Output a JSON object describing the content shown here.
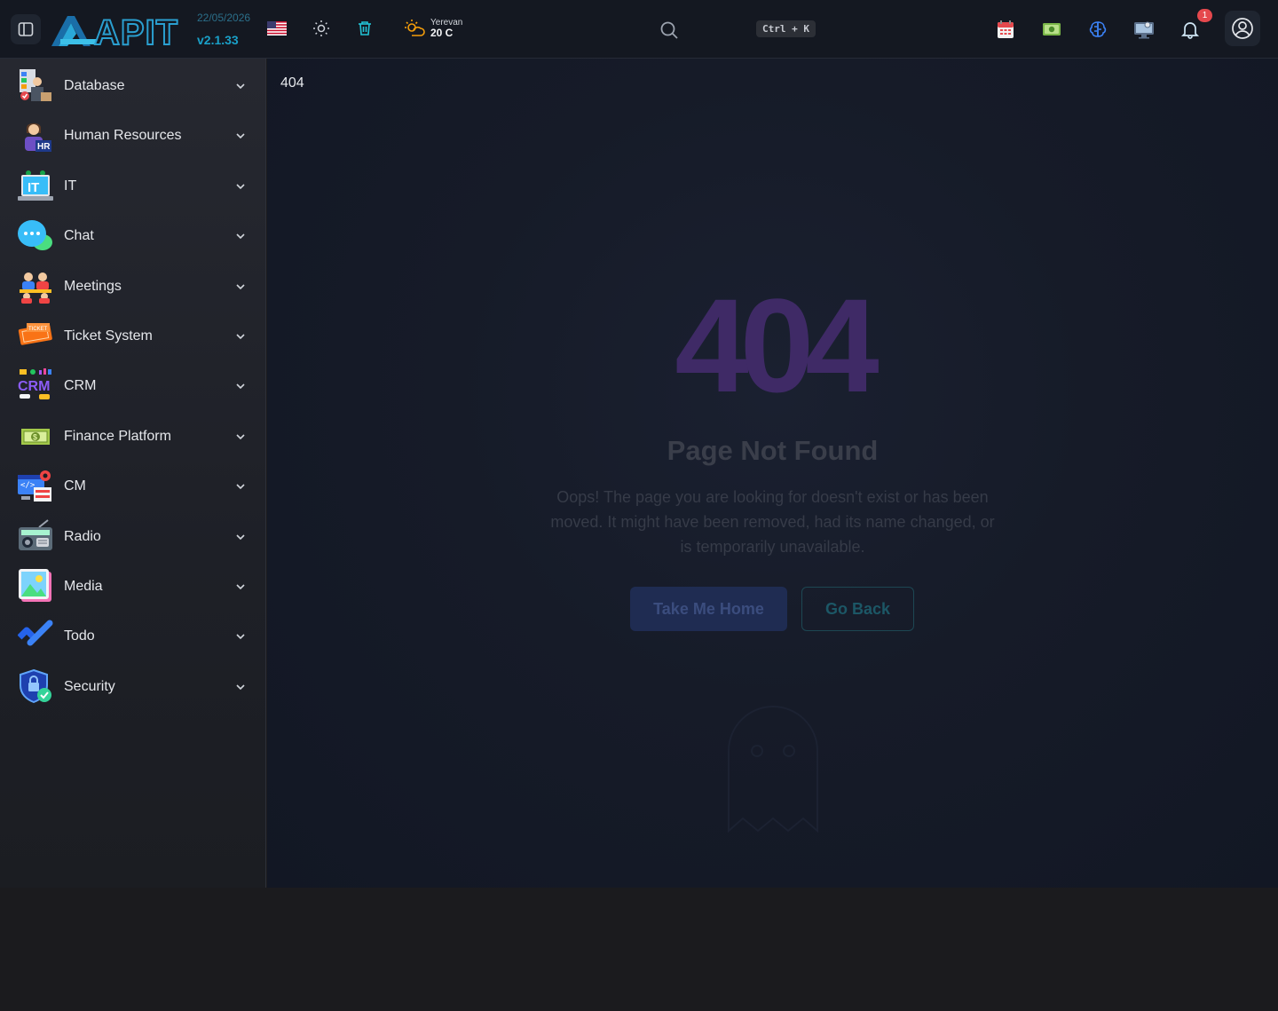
{
  "header": {
    "logo_text": "APIT",
    "date": "22/05/2026",
    "version": "v2.1.33",
    "weather": {
      "city": "Yerevan",
      "temp": "20 C"
    },
    "search_shortcut": "Ctrl + K",
    "notification_count": "1",
    "icons": [
      "sidebar-toggle-icon",
      "us-flag-icon",
      "sun-icon",
      "trash-icon",
      "weather-icon",
      "search-icon",
      "calendar-icon",
      "money-icon",
      "brain-icon",
      "monitor-icon",
      "bell-icon",
      "user-icon"
    ]
  },
  "sidebar": {
    "items": [
      {
        "label": "Database",
        "icon": "database-icon"
      },
      {
        "label": "Human Resources",
        "icon": "hr-icon"
      },
      {
        "label": "IT",
        "icon": "it-icon"
      },
      {
        "label": "Chat",
        "icon": "chat-icon"
      },
      {
        "label": "Meetings",
        "icon": "meetings-icon"
      },
      {
        "label": "Ticket System",
        "icon": "ticket-icon"
      },
      {
        "label": "CRM",
        "icon": "crm-icon"
      },
      {
        "label": "Finance Platform",
        "icon": "finance-icon"
      },
      {
        "label": "CM",
        "icon": "cm-icon"
      },
      {
        "label": "Radio",
        "icon": "radio-icon"
      },
      {
        "label": "Media",
        "icon": "media-icon"
      },
      {
        "label": "Todo",
        "icon": "todo-icon"
      },
      {
        "label": "Security",
        "icon": "security-icon"
      }
    ]
  },
  "main": {
    "breadcrumb": "404",
    "code": "404",
    "title": "Page Not Found",
    "description": "Oops! The page you are looking for doesn't exist or has been moved. It might have been removed, had its name changed, or is temporarily unavailable.",
    "home_button": "Take Me Home",
    "back_button": "Go Back"
  },
  "colors": {
    "accent": "#1aa0c8",
    "code_purple": "#3f2a66",
    "badge_red": "#e5484d"
  }
}
